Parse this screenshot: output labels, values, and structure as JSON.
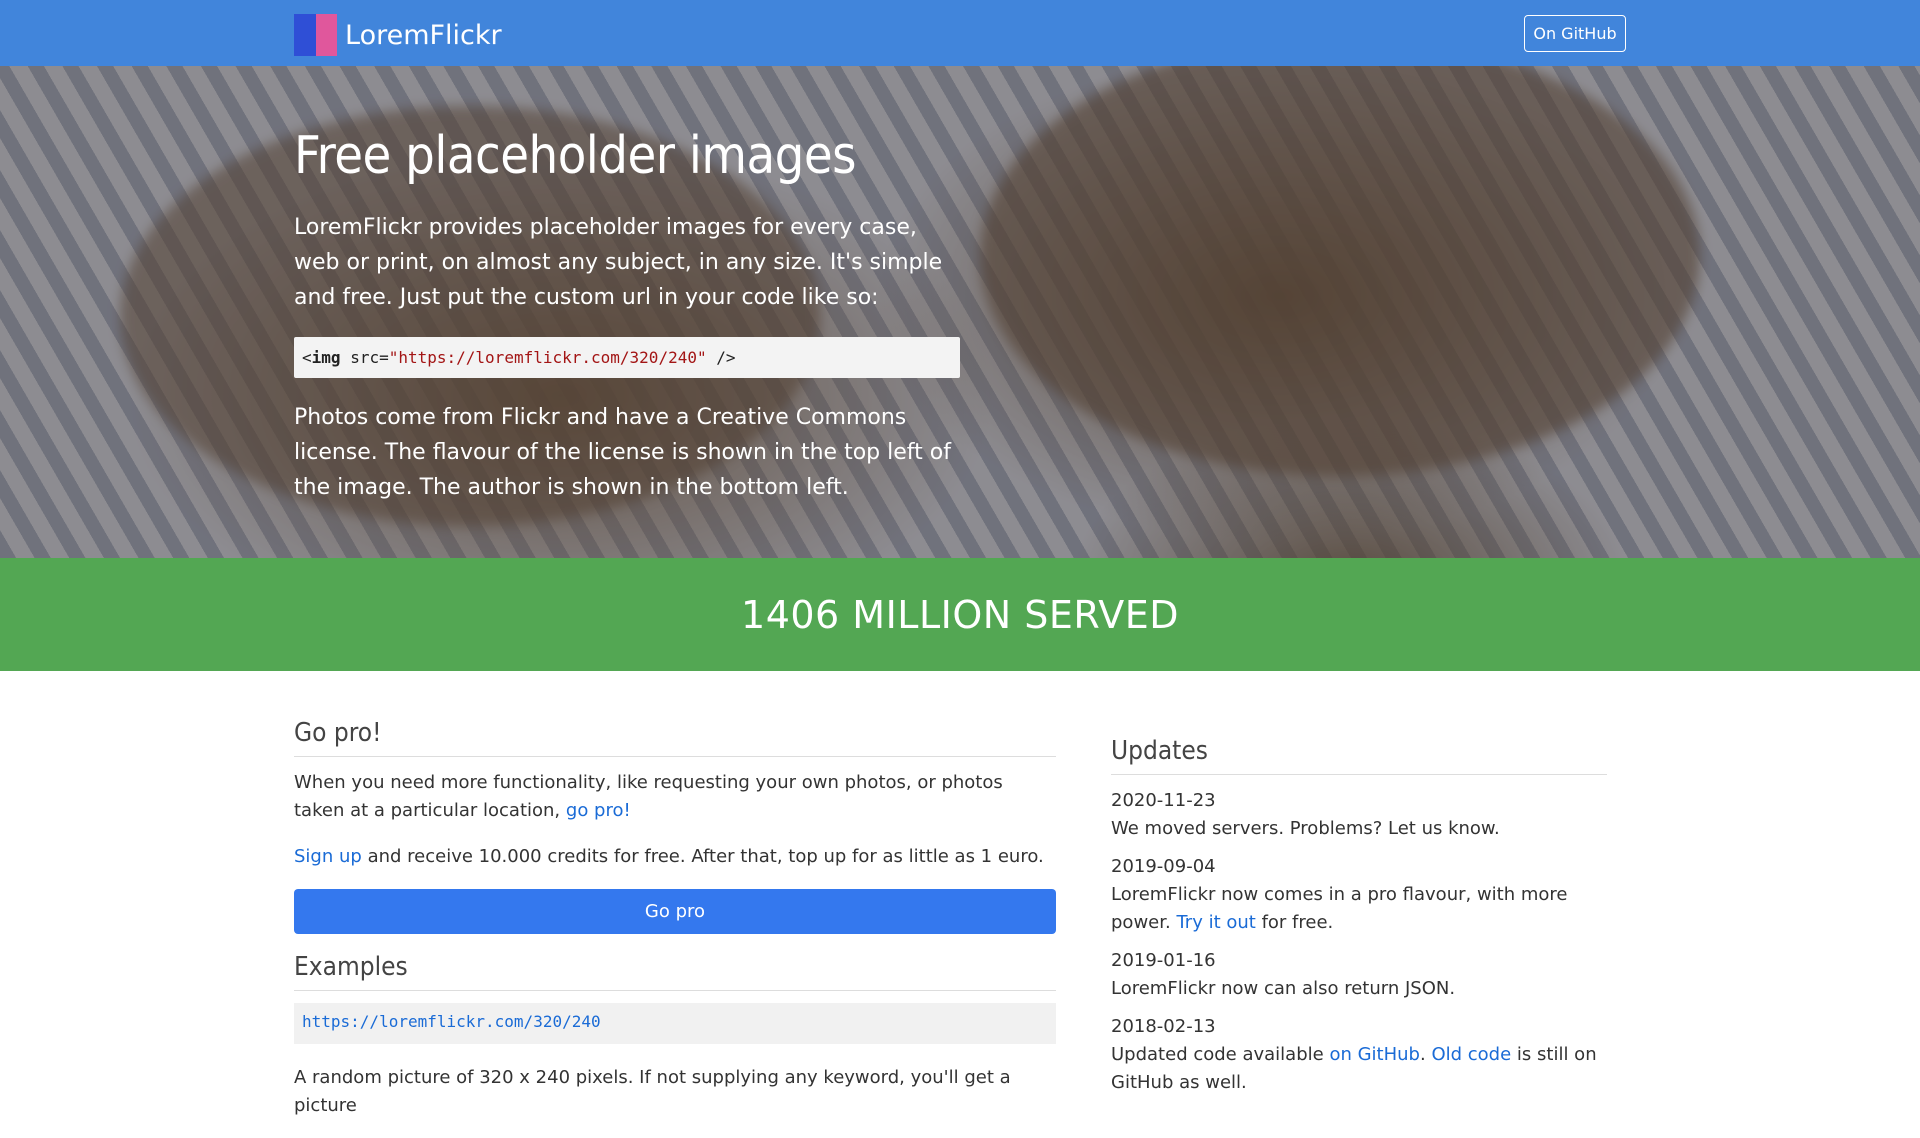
{
  "navbar": {
    "brand": "LoremFlickr",
    "github_button": "On GitHub",
    "logo_colors": [
      "#2f4fd6",
      "#e0579c"
    ]
  },
  "hero": {
    "title": "Free placeholder images",
    "intro": "LoremFlickr provides placeholder images for every case, web or print, on almost any subject, in any size. It's simple and free. Just put the custom url in your code like so:",
    "code_tag": "img",
    "code_attr": "src=",
    "code_url": "\"https://loremflickr.com/320/240\"",
    "code_close": "/>",
    "license_text": "Photos come from Flickr and have a Creative Commons license. The flavour of the license is shown in the top left of the image. The author is shown in the bottom left."
  },
  "banner": {
    "text": "1406 MILLION SERVED",
    "color": "#53a753"
  },
  "gopro": {
    "title": "Go pro!",
    "text_before": "When you need more functionality, like requesting your own photos, or photos taken at a particular location,",
    "link": "go pro!",
    "signup_link": "Sign up",
    "signup_text": "and receive 10.000 credits for free. After that, top up for as little as 1 euro.",
    "button": "Go pro"
  },
  "examples": {
    "title": "Examples",
    "url": "https://loremflickr.com/320/240",
    "description": "A random picture of 320 x 240 pixels. If not supplying any keyword, you'll get a picture"
  },
  "updates": {
    "title": "Updates",
    "items": [
      {
        "date": "2020-11-23",
        "text": "We moved servers. Problems? Let us know."
      },
      {
        "date": "2019-09-04",
        "text_before": "LoremFlickr now comes in a pro flavour, with more power.",
        "link": "Try it out",
        "text_after": "for free."
      },
      {
        "date": "2019-01-16",
        "text": "LoremFlickr now can also return JSON."
      },
      {
        "date": "2018-02-13",
        "text_before": "Updated code available",
        "link1": "on GitHub",
        "sep": ".",
        "link2": "Old code",
        "text_after": "is still on GitHub as well."
      }
    ]
  }
}
